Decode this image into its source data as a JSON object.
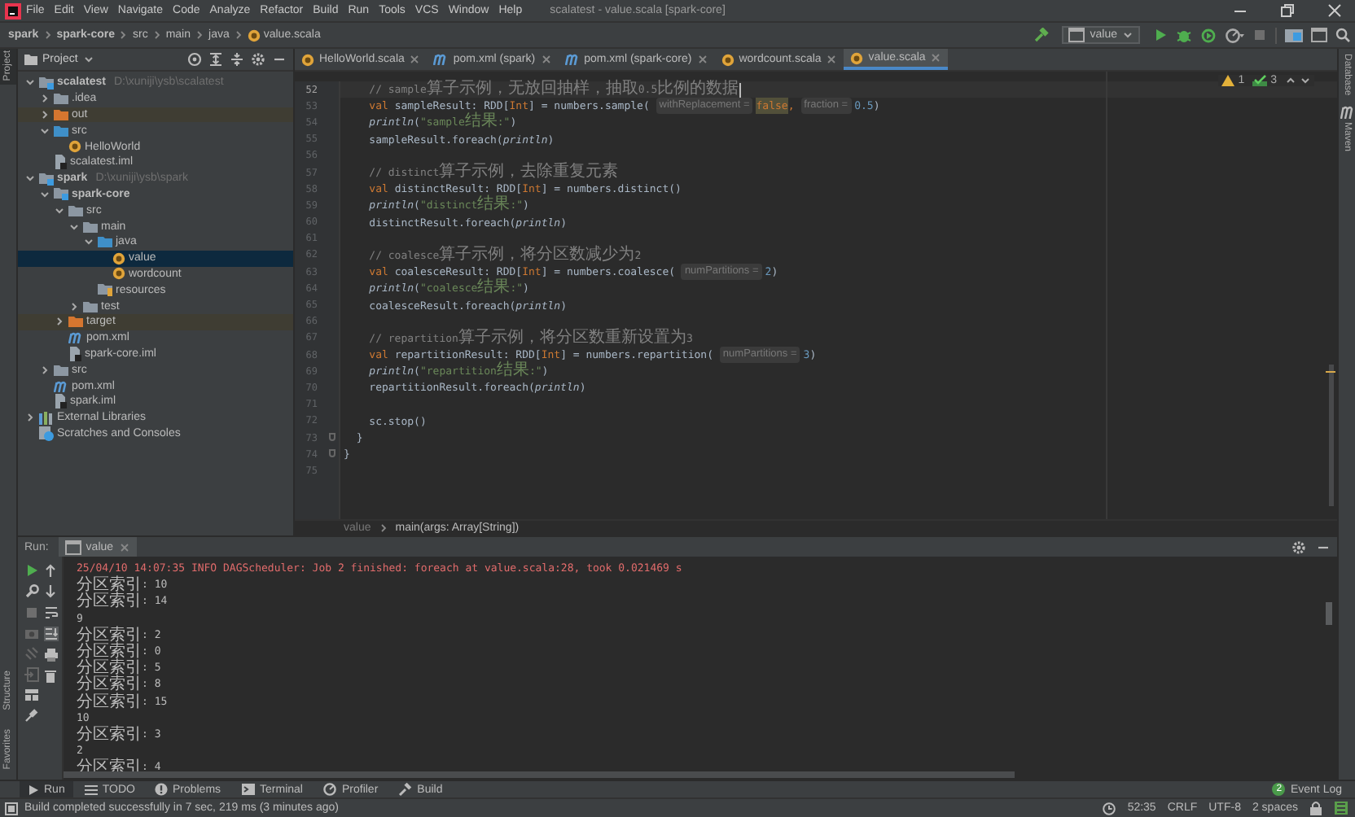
{
  "window": {
    "title": "scalatest - value.scala [spark-core]"
  },
  "menu": [
    "File",
    "Edit",
    "View",
    "Navigate",
    "Code",
    "Analyze",
    "Refactor",
    "Build",
    "Run",
    "Tools",
    "VCS",
    "Window",
    "Help"
  ],
  "nav_path": [
    {
      "label": "spark",
      "kind": "module"
    },
    {
      "label": "spark-core",
      "kind": "module"
    },
    {
      "label": "src",
      "kind": "folder"
    },
    {
      "label": "main",
      "kind": "folder"
    },
    {
      "label": "java",
      "kind": "folder"
    },
    {
      "label": "value.scala",
      "kind": "file"
    }
  ],
  "run_config": {
    "label": "value"
  },
  "left_strip": {
    "top": [
      {
        "label": "Project",
        "selected": true
      }
    ],
    "bottom": [
      {
        "label": "Structure",
        "selected": false
      },
      {
        "label": "Favorites",
        "selected": false
      }
    ]
  },
  "right_strip": [
    {
      "label": "Database",
      "kind": "database"
    },
    {
      "label": "Maven",
      "kind": "maven"
    }
  ],
  "project_panel": {
    "title": "Project",
    "tree": [
      {
        "label": "scalatest",
        "kind": "module",
        "hint": "D:\\xuniji\\ysb\\scalatest",
        "expanded": true,
        "selected": false,
        "children": [
          {
            "label": ".idea",
            "kind": "folder",
            "expanded": false,
            "selected": false
          },
          {
            "label": "out",
            "kind": "excluded",
            "expanded": false,
            "selected": false
          },
          {
            "label": "src",
            "kind": "source",
            "expanded": true,
            "selected": false,
            "children": [
              {
                "label": "HelloWorld",
                "kind": "object",
                "selected": false
              }
            ]
          },
          {
            "label": "scalatest.iml",
            "kind": "iml",
            "selected": false
          }
        ]
      },
      {
        "label": "spark",
        "kind": "module",
        "hint": "D:\\xuniji\\ysb\\spark",
        "expanded": true,
        "selected": false,
        "children": [
          {
            "label": "spark-core",
            "kind": "module",
            "expanded": true,
            "selected": false,
            "children": [
              {
                "label": "src",
                "kind": "folder",
                "expanded": true,
                "selected": false,
                "children": [
                  {
                    "label": "main",
                    "kind": "folder",
                    "expanded": true,
                    "selected": false,
                    "children": [
                      {
                        "label": "java",
                        "kind": "source",
                        "expanded": true,
                        "selected": false,
                        "children": [
                          {
                            "label": "value",
                            "kind": "object",
                            "selected": true
                          },
                          {
                            "label": "wordcount",
                            "kind": "object",
                            "selected": false
                          }
                        ]
                      },
                      {
                        "label": "resources",
                        "kind": "resources",
                        "selected": false
                      }
                    ]
                  },
                  {
                    "label": "test",
                    "kind": "folder",
                    "expanded": false,
                    "selected": false
                  }
                ]
              },
              {
                "label": "target",
                "kind": "excluded",
                "expanded": false,
                "selected": false
              },
              {
                "label": "pom.xml",
                "kind": "maven",
                "selected": false
              },
              {
                "label": "spark-core.iml",
                "kind": "iml",
                "selected": false
              }
            ]
          },
          {
            "label": "src",
            "kind": "folder",
            "expanded": false,
            "selected": false
          },
          {
            "label": "pom.xml",
            "kind": "maven",
            "selected": false
          },
          {
            "label": "spark.iml",
            "kind": "iml",
            "selected": false
          }
        ]
      },
      {
        "label": "External Libraries",
        "kind": "libraries",
        "expanded": false,
        "selected": false
      },
      {
        "label": "Scratches and Consoles",
        "kind": "scratches",
        "selected": false
      }
    ]
  },
  "tabs": [
    {
      "label": "HelloWorld.scala",
      "kind": "scala",
      "selected": false
    },
    {
      "label": "pom.xml (spark)",
      "kind": "maven",
      "selected": false
    },
    {
      "label": "pom.xml (spark-core)",
      "kind": "maven",
      "selected": false
    },
    {
      "label": "wordcount.scala",
      "kind": "scala",
      "selected": false
    },
    {
      "label": "value.scala",
      "kind": "scala",
      "selected": true
    }
  ],
  "inspections": {
    "warnings": "1",
    "passed": "3"
  },
  "code": [
    {
      "number": "52",
      "current": true,
      "tokens": [
        {
          "kind": "comment",
          "text": "    // sample算子示例，无放回抽样，抽取0.5比例的数据"
        }
      ]
    },
    {
      "number": "53",
      "current": false,
      "tokens": [
        {
          "kind": "keyword",
          "text": "    val "
        },
        {
          "kind": "plain",
          "text": "sampleResult: RDD["
        },
        {
          "kind": "type",
          "text": "Int"
        },
        {
          "kind": "plain",
          "text": "] = numbers.sample( "
        },
        {
          "kind": "hint",
          "text": "withReplacement ="
        },
        {
          "kind": "flag",
          "text": "false"
        },
        {
          "kind": "keyword",
          "text": ", "
        },
        {
          "kind": "hint",
          "text": "fraction ="
        },
        {
          "kind": "number",
          "text": "0.5"
        },
        {
          "kind": "plain",
          "text": ")"
        }
      ]
    },
    {
      "number": "54",
      "current": false,
      "tokens": [
        {
          "kind": "call",
          "text": "    println"
        },
        {
          "kind": "plain",
          "text": "("
        },
        {
          "kind": "string",
          "text": "\"sample结果:\""
        },
        {
          "kind": "plain",
          "text": ")"
        }
      ]
    },
    {
      "number": "55",
      "current": false,
      "tokens": [
        {
          "kind": "plain",
          "text": "    sampleResult.foreach("
        },
        {
          "kind": "call",
          "text": "println"
        },
        {
          "kind": "plain",
          "text": ")"
        }
      ]
    },
    {
      "number": "56",
      "current": false
    },
    {
      "number": "57",
      "current": false,
      "tokens": [
        {
          "kind": "comment",
          "text": "    // distinct算子示例，去除重复元素"
        }
      ]
    },
    {
      "number": "58",
      "current": false,
      "tokens": [
        {
          "kind": "keyword",
          "text": "    val "
        },
        {
          "kind": "plain",
          "text": "distinctResult: RDD["
        },
        {
          "kind": "type",
          "text": "Int"
        },
        {
          "kind": "plain",
          "text": "] = numbers.distinct()"
        }
      ]
    },
    {
      "number": "59",
      "current": false,
      "tokens": [
        {
          "kind": "call",
          "text": "    println"
        },
        {
          "kind": "plain",
          "text": "("
        },
        {
          "kind": "string",
          "text": "\"distinct结果:\""
        },
        {
          "kind": "plain",
          "text": ")"
        }
      ]
    },
    {
      "number": "60",
      "current": false,
      "tokens": [
        {
          "kind": "plain",
          "text": "    distinctResult.foreach("
        },
        {
          "kind": "call",
          "text": "println"
        },
        {
          "kind": "plain",
          "text": ")"
        }
      ]
    },
    {
      "number": "61",
      "current": false
    },
    {
      "number": "62",
      "current": false,
      "tokens": [
        {
          "kind": "comment",
          "text": "    // coalesce算子示例，将分区数减少为2"
        }
      ]
    },
    {
      "number": "63",
      "current": false,
      "tokens": [
        {
          "kind": "keyword",
          "text": "    val "
        },
        {
          "kind": "plain",
          "text": "coalesceResult: RDD["
        },
        {
          "kind": "type",
          "text": "Int"
        },
        {
          "kind": "plain",
          "text": "] = numbers.coalesce( "
        },
        {
          "kind": "hint",
          "text": "numPartitions ="
        },
        {
          "kind": "number",
          "text": "2"
        },
        {
          "kind": "plain",
          "text": ")"
        }
      ]
    },
    {
      "number": "64",
      "current": false,
      "tokens": [
        {
          "kind": "call",
          "text": "    println"
        },
        {
          "kind": "plain",
          "text": "("
        },
        {
          "kind": "string",
          "text": "\"coalesce结果:\""
        },
        {
          "kind": "plain",
          "text": ")"
        }
      ]
    },
    {
      "number": "65",
      "current": false,
      "tokens": [
        {
          "kind": "plain",
          "text": "    coalesceResult.foreach("
        },
        {
          "kind": "call",
          "text": "println"
        },
        {
          "kind": "plain",
          "text": ")"
        }
      ]
    },
    {
      "number": "66",
      "current": false
    },
    {
      "number": "67",
      "current": false,
      "tokens": [
        {
          "kind": "comment",
          "text": "    // repartition算子示例，将分区数重新设置为3"
        }
      ]
    },
    {
      "number": "68",
      "current": false,
      "tokens": [
        {
          "kind": "keyword",
          "text": "    val "
        },
        {
          "kind": "plain",
          "text": "repartitionResult: RDD["
        },
        {
          "kind": "type",
          "text": "Int"
        },
        {
          "kind": "plain",
          "text": "] = numbers.repartition( "
        },
        {
          "kind": "hint",
          "text": "numPartitions ="
        },
        {
          "kind": "number",
          "text": "3"
        },
        {
          "kind": "plain",
          "text": ")"
        }
      ]
    },
    {
      "number": "69",
      "current": false,
      "tokens": [
        {
          "kind": "call",
          "text": "    println"
        },
        {
          "kind": "plain",
          "text": "("
        },
        {
          "kind": "string",
          "text": "\"repartition结果:\""
        },
        {
          "kind": "plain",
          "text": ")"
        }
      ]
    },
    {
      "number": "70",
      "current": false,
      "tokens": [
        {
          "kind": "plain",
          "text": "    repartitionResult.foreach("
        },
        {
          "kind": "call",
          "text": "println"
        },
        {
          "kind": "plain",
          "text": ")"
        }
      ]
    },
    {
      "number": "71",
      "current": false
    },
    {
      "number": "72",
      "current": false,
      "tokens": [
        {
          "kind": "plain",
          "text": "    sc.stop()"
        }
      ]
    },
    {
      "number": "73",
      "current": false,
      "tokens": [
        {
          "kind": "plain",
          "text": "  }"
        }
      ]
    },
    {
      "number": "74",
      "current": false,
      "tokens": [
        {
          "kind": "plain",
          "text": "}"
        }
      ]
    },
    {
      "number": "75",
      "current": false
    }
  ],
  "editor_breadcrumb": [
    "value",
    "main(args: Array[String])"
  ],
  "run_panel": {
    "title": "Run:",
    "tab": "value",
    "console": [
      {
        "kind": "log",
        "text": "25/04/10 14:07:35 INFO DAGScheduler: Job 2 finished: foreach at value.scala:28, took 0.021469 s"
      },
      {
        "kind": "output",
        "text": "分区索引: 10"
      },
      {
        "kind": "output",
        "text": "分区索引: 14"
      },
      {
        "kind": "output",
        "text": "9"
      },
      {
        "kind": "output",
        "text": "分区索引: 2"
      },
      {
        "kind": "output",
        "text": "分区索引: 0"
      },
      {
        "kind": "output",
        "text": "分区索引: 5"
      },
      {
        "kind": "output",
        "text": "分区索引: 8"
      },
      {
        "kind": "output",
        "text": "分区索引: 15"
      },
      {
        "kind": "output",
        "text": "10"
      },
      {
        "kind": "output",
        "text": "分区索引: 3"
      },
      {
        "kind": "output",
        "text": "2"
      },
      {
        "kind": "output",
        "text": "分区索引: 4"
      }
    ]
  },
  "tool_windows": [
    {
      "label": "Run",
      "kind": "run",
      "selected": true
    },
    {
      "label": "TODO",
      "kind": "todo",
      "selected": false
    },
    {
      "label": "Problems",
      "kind": "problems",
      "selected": false
    },
    {
      "label": "Terminal",
      "kind": "terminal",
      "selected": false
    },
    {
      "label": "Profiler",
      "kind": "profiler",
      "selected": false
    },
    {
      "label": "Build",
      "kind": "build",
      "selected": false
    }
  ],
  "event_log": {
    "label": "Event Log",
    "badge": "2"
  },
  "status_bar": {
    "message": "Build completed successfully in 7 sec, 219 ms (3 minutes ago)",
    "items": [
      "52:35",
      "CRLF",
      "UTF-8",
      "2 spaces"
    ]
  }
}
